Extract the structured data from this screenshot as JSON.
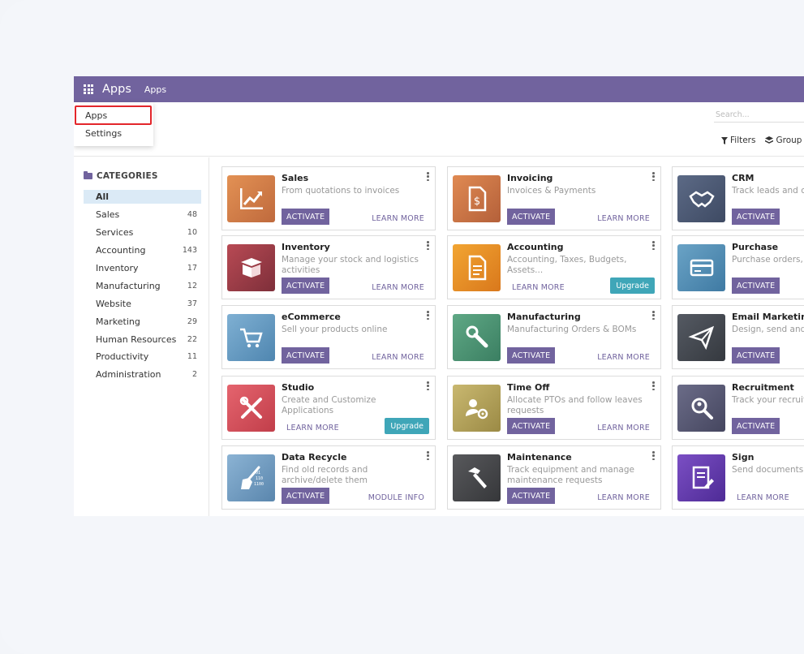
{
  "navbar": {
    "title": "Apps",
    "menu": "Apps"
  },
  "dropdown": {
    "items": [
      "Apps",
      "Settings"
    ]
  },
  "search": {
    "placeholder": "Search..."
  },
  "toolbar": {
    "filters": "Filters",
    "group": "Group"
  },
  "sidebar": {
    "heading": "CATEGORIES",
    "items": [
      {
        "label": "All",
        "count": ""
      },
      {
        "label": "Sales",
        "count": "48"
      },
      {
        "label": "Services",
        "count": "10"
      },
      {
        "label": "Accounting",
        "count": "143"
      },
      {
        "label": "Inventory",
        "count": "17"
      },
      {
        "label": "Manufacturing",
        "count": "12"
      },
      {
        "label": "Website",
        "count": "37"
      },
      {
        "label": "Marketing",
        "count": "29"
      },
      {
        "label": "Human Resources",
        "count": "22"
      },
      {
        "label": "Productivity",
        "count": "11"
      },
      {
        "label": "Administration",
        "count": "2"
      }
    ]
  },
  "buttons": {
    "activate": "ACTIVATE",
    "learn_more": "LEARN MORE",
    "upgrade": "Upgrade",
    "module_info": "MODULE INFO"
  },
  "apps": [
    {
      "title": "Sales",
      "desc": "From quotations to invoices"
    },
    {
      "title": "Invoicing",
      "desc": "Invoices & Payments"
    },
    {
      "title": "CRM",
      "desc": "Track leads and cl"
    },
    {
      "title": "Inventory",
      "desc": "Manage your stock and logistics activities"
    },
    {
      "title": "Accounting",
      "desc": "Accounting, Taxes, Budgets, Assets..."
    },
    {
      "title": "Purchase",
      "desc": "Purchase orders, t agreements"
    },
    {
      "title": "eCommerce",
      "desc": "Sell your products online"
    },
    {
      "title": "Manufacturing",
      "desc": "Manufacturing Orders & BOMs"
    },
    {
      "title": "Email Marketing",
      "desc": "Design, send and t"
    },
    {
      "title": "Studio",
      "desc": "Create and Customize Applications"
    },
    {
      "title": "Time Off",
      "desc": "Allocate PTOs and follow leaves requests"
    },
    {
      "title": "Recruitment",
      "desc": "Track your recruit"
    },
    {
      "title": "Data Recycle",
      "desc": "Find old records and archive/delete them"
    },
    {
      "title": "Maintenance",
      "desc": "Track equipment and manage maintenance requests"
    },
    {
      "title": "Sign",
      "desc": "Send documents t"
    }
  ],
  "colors": {
    "brand": "#71639e",
    "upgrade": "#3fa6b8",
    "highlight": "#e3262b",
    "active_category": "#dbeaf6"
  }
}
